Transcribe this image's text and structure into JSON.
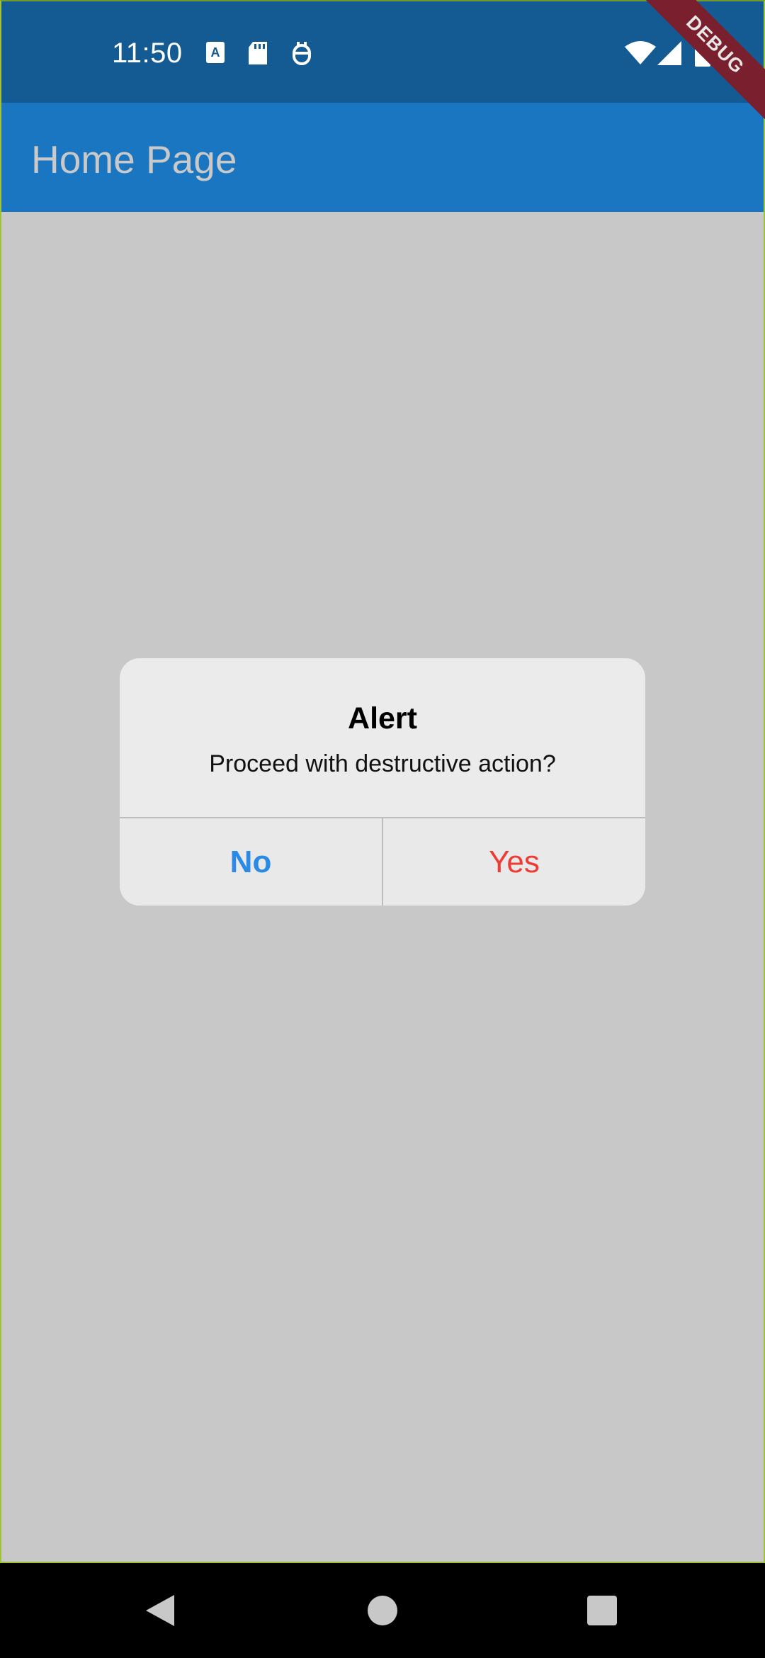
{
  "status_bar": {
    "time": "11:50",
    "left_icons": [
      "text-a-icon",
      "sd-card-icon",
      "debug-bug-icon"
    ],
    "right_icons": [
      "wifi-icon",
      "signal-icon",
      "battery-icon"
    ]
  },
  "app_bar": {
    "title": "Home Page"
  },
  "debug_banner": {
    "label": "DEBUG"
  },
  "dialog": {
    "title": "Alert",
    "message": "Proceed with destructive action?",
    "buttons": [
      {
        "label": "No",
        "color": "#2a8ae6"
      },
      {
        "label": "Yes",
        "color": "#ef3b34"
      }
    ]
  },
  "nav_bar": {
    "buttons": [
      "back-icon",
      "home-icon",
      "recents-icon"
    ]
  },
  "colors": {
    "status_bar": "#135b92",
    "app_bar": "#1a76c1",
    "scrim": "#c8c8c8",
    "dialog": "#ebebeb"
  }
}
